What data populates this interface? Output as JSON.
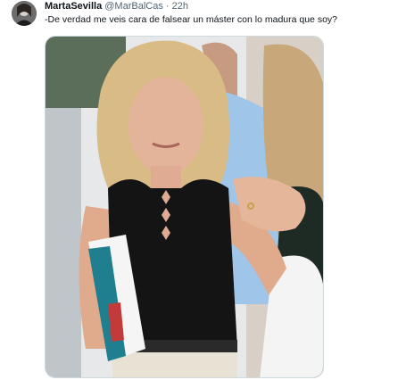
{
  "tweet": {
    "author": {
      "display_name": "MartaSevilla",
      "handle": "@MarBalCas",
      "avatar_icon": "user-avatar-icon"
    },
    "separator": "·",
    "timestamp": "22h",
    "text": "-De verdad me veis cara de falsear un máster con lo madura que soy?",
    "media": {
      "kind": "photo",
      "icon": "photo-icon"
    }
  },
  "colors": {
    "text_primary": "#0f1419",
    "text_secondary": "#536471",
    "border": "#cfd9de"
  }
}
